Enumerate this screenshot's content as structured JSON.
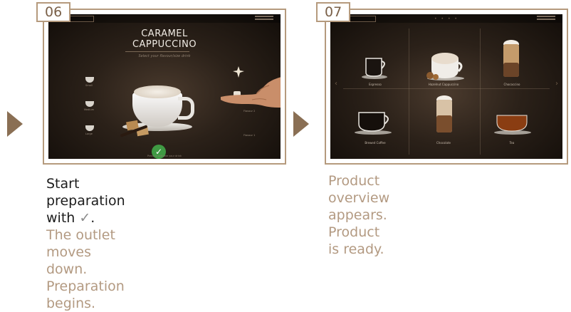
{
  "steps": [
    {
      "number": "06",
      "screen": {
        "title_line1": "CARAMEL",
        "title_line2": "CAPPUCCINO",
        "subtitle": "Select your flavour/size drink",
        "sizes": [
          "Small",
          "Medium",
          "Large"
        ],
        "flavours": [
          "",
          "Flavour 2",
          "Flavour 1"
        ],
        "confirm_symbol": "✓",
        "bottom_hint": "Press to activate your drink"
      },
      "caption": {
        "line1": "Start preparation with",
        "check": "✓",
        "period": ".",
        "line2": "The outlet moves down.",
        "line3": "Preparation begins."
      }
    },
    {
      "number": "07",
      "screen": {
        "pager": "• • • •",
        "products": [
          "Espresso",
          "Hazelnut Cappuccino",
          "Chococcino",
          "Brewed Coffee",
          "Chocolate",
          "Tea"
        ],
        "nav_left": "‹",
        "nav_right": "›"
      },
      "caption": {
        "line1": "Product overview appears.",
        "line2": "Product is ready."
      }
    }
  ],
  "colors": {
    "frame": "#b59a7d",
    "accent_text": "#b39a82",
    "confirm_green": "#3f9a43"
  }
}
